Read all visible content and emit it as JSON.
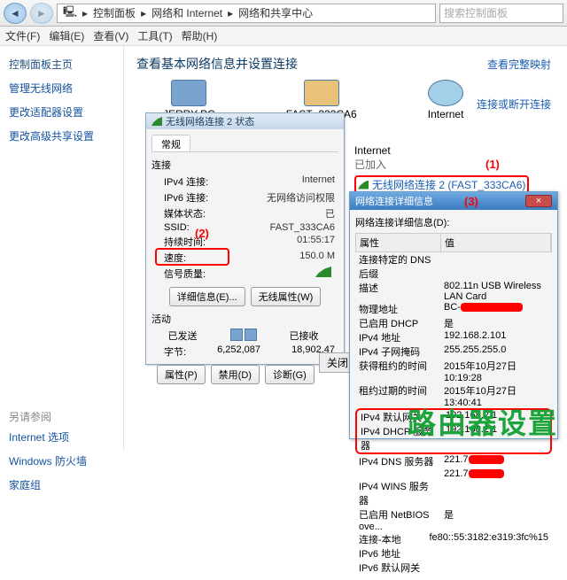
{
  "addressbar": {
    "bc1": "控制面板",
    "bc2": "网络和 Internet",
    "bc3": "网络和共享中心",
    "sep": "▸",
    "search_placeholder": "搜索控制面板"
  },
  "menu": {
    "file": "文件(F)",
    "edit": "编辑(E)",
    "view": "查看(V)",
    "tools": "工具(T)",
    "help": "帮助(H)"
  },
  "sidebar": {
    "home": "控制面板主页",
    "links": [
      "管理无线网络",
      "更改适配器设置",
      "更改高级共享设置"
    ],
    "see_also": "另请参阅",
    "extra": [
      "Internet 选项",
      "Windows 防火墙",
      "家庭组"
    ]
  },
  "main": {
    "title": "查看基本网络信息并设置连接",
    "icons": {
      "pc": "JERRY-PC",
      "router": "FAST_333CA6",
      "internet": "Internet"
    },
    "right1": "查看完整映射",
    "right2": "连接或断开连接",
    "netblock": {
      "title": "Internet",
      "joined": "已加入",
      "wifi": "无线网络连接 2 (FAST_333CA6)"
    }
  },
  "annot": {
    "a1": "(1)",
    "a2": "(2)",
    "a3": "(3)"
  },
  "dlg1": {
    "title": "无线网络连接 2 状态",
    "tab": "常规",
    "sec_conn": "连接",
    "rows": {
      "ipv4": "IPv4 连接:",
      "ipv4_v": "Internet",
      "ipv6": "IPv6 连接:",
      "ipv6_v": "无网络访问权限",
      "media": "媒体状态:",
      "media_v": "已",
      "ssid": "SSID:",
      "ssid_v": "FAST_333CA6",
      "dur": "持续时间:",
      "dur_v": "01:55:17",
      "speed": "速度:",
      "speed_v": "150.0 M",
      "signal": "信号质量:"
    },
    "btn_detail": "详细信息(E)...",
    "btn_wprops": "无线属性(W)",
    "sec_act": "活动",
    "sent": "已发送",
    "recv": "已接收",
    "bytes_lbl": "字节:",
    "bytes_sent": "6,252,087",
    "bytes_recv": "18,902,47",
    "btn_props": "属性(P)",
    "btn_disable": "禁用(D)",
    "btn_diag": "诊断(G)"
  },
  "dlg2": {
    "title": "网络连接详细信息",
    "subtitle": "网络连接详细信息(D):",
    "hdr1": "属性",
    "hdr2": "值",
    "rows": [
      {
        "p": "连接特定的 DNS 后缀",
        "v": ""
      },
      {
        "p": "描述",
        "v": "802.11n USB Wireless LAN Card"
      },
      {
        "p": "物理地址",
        "v": "BC-"
      },
      {
        "p": "已启用 DHCP",
        "v": "是"
      },
      {
        "p": "IPv4 地址",
        "v": "192.168.2.101"
      },
      {
        "p": "IPv4 子网掩码",
        "v": "255.255.255.0"
      },
      {
        "p": "获得租约的时间",
        "v": "2015年10月27日 10:19:28"
      },
      {
        "p": "租约过期的时间",
        "v": "2015年10月27日 13:40:41"
      },
      {
        "p": "IPv4 默认网关",
        "v": "192.168.2.1"
      },
      {
        "p": "IPv4 DHCP 服务器",
        "v": "192.168.2.1"
      },
      {
        "p": "IPv4 DNS 服务器",
        "v": "221.7"
      },
      {
        "p": "",
        "v": "221.7"
      },
      {
        "p": "IPv4 WINS 服务器",
        "v": ""
      },
      {
        "p": "已启用 NetBIOS ove...",
        "v": "是"
      },
      {
        "p": "连接-本地 IPv6 地址",
        "v": "fe80::55:3182:e319:3fc%15"
      },
      {
        "p": "IPv6 默认网关",
        "v": ""
      }
    ]
  },
  "close_btn": "关闭",
  "banner": "路由器设置"
}
